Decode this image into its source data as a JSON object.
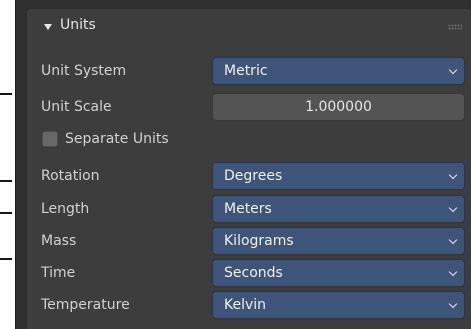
{
  "panel": {
    "title": "Units",
    "grip_icon": "grip-dots-icon",
    "expand_icon": "triangle-down-icon",
    "accent_color": "#3f5479"
  },
  "rows": {
    "unit_system": {
      "label": "Unit System",
      "value": "Metric"
    },
    "unit_scale": {
      "label": "Unit Scale",
      "value": "1.000000"
    },
    "separate_units": {
      "label": "Separate Units",
      "checked": false
    },
    "rotation": {
      "label": "Rotation",
      "value": "Degrees"
    },
    "length": {
      "label": "Length",
      "value": "Meters"
    },
    "mass": {
      "label": "Mass",
      "value": "Kilograms"
    },
    "time": {
      "label": "Time",
      "value": "Seconds"
    },
    "temperature": {
      "label": "Temperature",
      "value": "Kelvin"
    }
  }
}
